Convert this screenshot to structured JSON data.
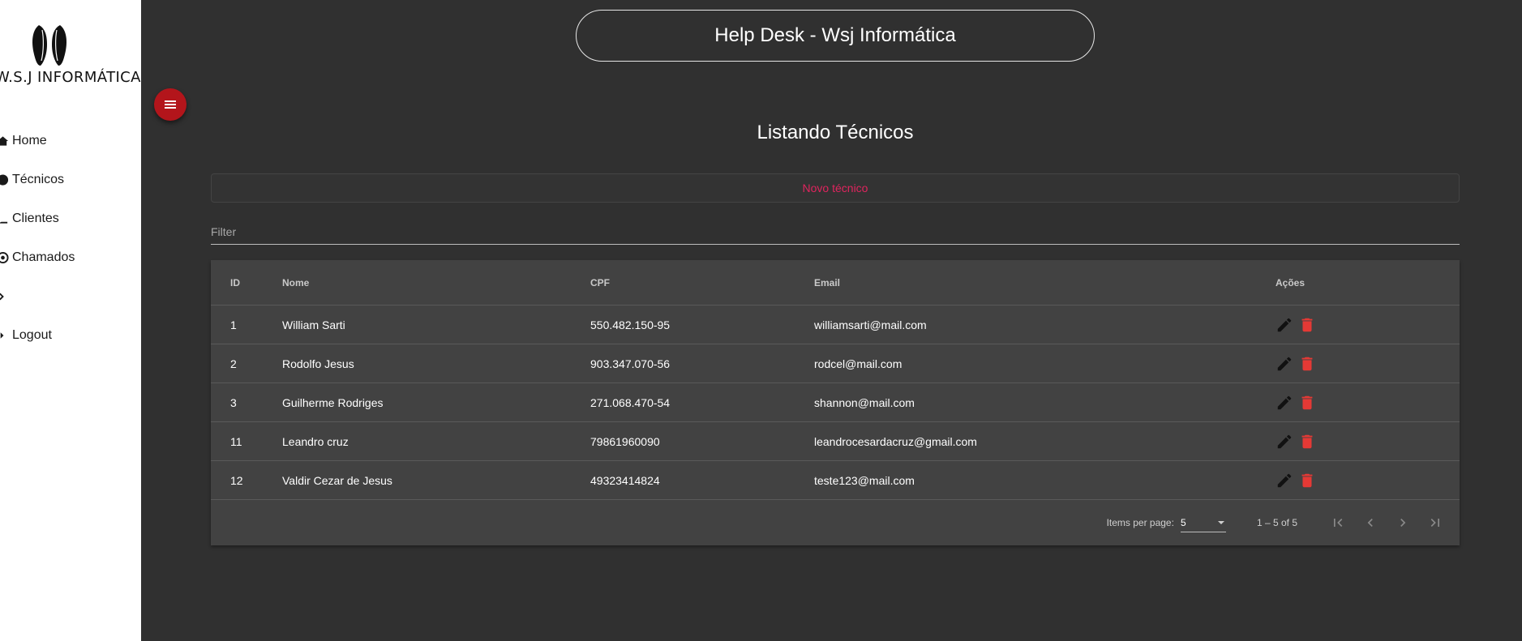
{
  "sidebar": {
    "logo_text": "W.S.J INFORMÁTICA",
    "items": [
      {
        "label": "Home",
        "icon": "home-icon"
      },
      {
        "label": "Técnicos",
        "icon": "person-icon"
      },
      {
        "label": "Clientes",
        "icon": "people-icon"
      },
      {
        "label": "Chamados",
        "icon": "support-icon"
      },
      {
        "label": "",
        "icon": "arrow-icon"
      },
      {
        "label": "Logout",
        "icon": "logout-icon"
      }
    ]
  },
  "header": {
    "title": "Help Desk - Wsj Informática"
  },
  "menu_button_icon": "menu-icon",
  "page": {
    "title": "Listando Técnicos",
    "new_button": "Novo técnico",
    "filter_placeholder": "Filter"
  },
  "table": {
    "columns": [
      "ID",
      "Nome",
      "CPF",
      "Email",
      "Ações"
    ],
    "rows": [
      {
        "id": "1",
        "nome": "William Sarti",
        "cpf": "550.482.150-95",
        "email": "williamsarti@mail.com"
      },
      {
        "id": "2",
        "nome": "Rodolfo Jesus",
        "cpf": "903.347.070-56",
        "email": "rodcel@mail.com"
      },
      {
        "id": "3",
        "nome": "Guilherme Rodriges",
        "cpf": "271.068.470-54",
        "email": "shannon@mail.com"
      },
      {
        "id": "11",
        "nome": "Leandro cruz",
        "cpf": "79861960090",
        "email": "leandrocesardacruz@gmail.com"
      },
      {
        "id": "12",
        "nome": "Valdir Cezar de Jesus",
        "cpf": "49323414824",
        "email": "teste123@mail.com"
      }
    ]
  },
  "paginator": {
    "items_per_page_label": "Items per page:",
    "page_size": "5",
    "range_label": "1 – 5 of 5"
  },
  "colors": {
    "background": "#303030",
    "card": "#424242",
    "accent": "#e0245e",
    "delete": "#e53935",
    "fab": "#b3151b"
  }
}
